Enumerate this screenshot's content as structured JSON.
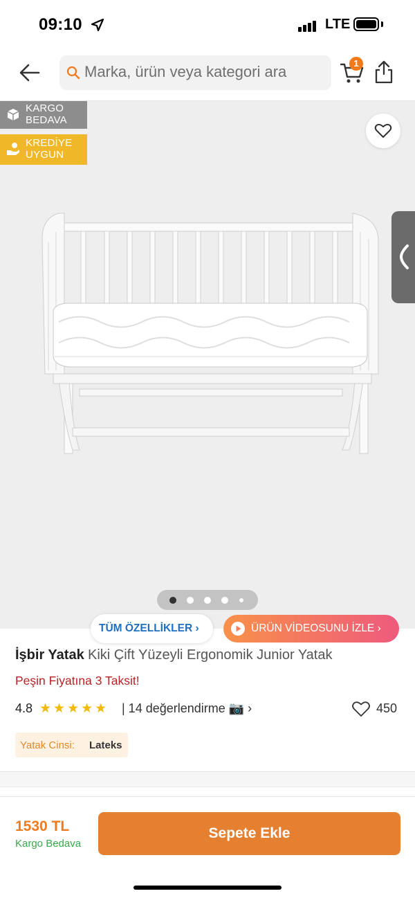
{
  "status_bar": {
    "time": "09:10",
    "network": "LTE"
  },
  "header": {
    "search_placeholder": "Marka, ürün veya kategori ara",
    "cart_count": "1"
  },
  "gallery": {
    "badges": [
      {
        "line1": "KARGO",
        "line2": "BEDAVA",
        "color": "#8d8d8d"
      },
      {
        "line1": "KREDİYE",
        "line2": "UYGUN",
        "color": "#f0b829"
      }
    ],
    "page_count": 5,
    "active_index": 0
  },
  "pills": {
    "features": "TÜM ÖZELLİKLER ›",
    "video": "ÜRÜN VİDEOSUNU İZLE ›"
  },
  "product": {
    "brand": "İşbir Yatak",
    "name": "Kiki Çift Yüzeyli Ergonomik Junior Yatak",
    "installment": "Peşin Fiyatına 3 Taksit!",
    "rating": "4.8",
    "review_text": "| 14 değerlendirme 📷 ›",
    "favorites": "450",
    "attribute_label": "Yatak Cinsi:",
    "attribute_value": "Lateks"
  },
  "footer": {
    "price": "1530 TL",
    "shipping": "Kargo Bedava",
    "add_to_cart": "Sepete Ekle"
  },
  "colors": {
    "brand_orange": "#f27a1a",
    "button_orange": "#e58031",
    "installment_red": "#b82226",
    "free_cargo_green": "#38a84a",
    "link_blue": "#1e6fbf"
  }
}
